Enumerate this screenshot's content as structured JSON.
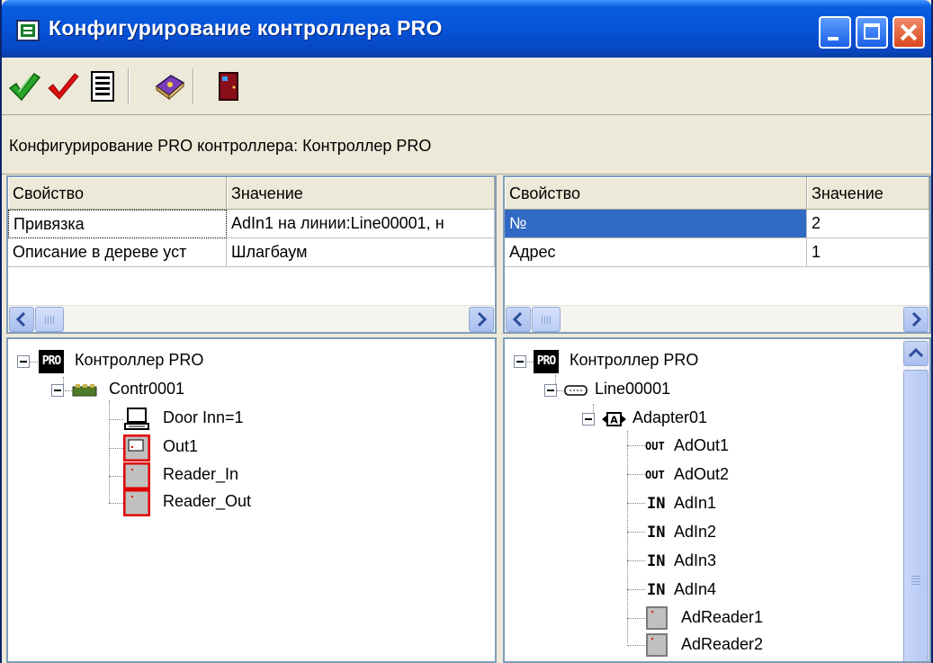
{
  "window": {
    "title": "Конфигурирование контроллера PRO"
  },
  "toolbar": {
    "buttons": [
      {
        "icon": "double-check-icon"
      },
      {
        "icon": "check-icon"
      },
      {
        "icon": "list-document-icon"
      },
      {
        "icon": "help-book-icon"
      },
      {
        "icon": "exit-door-icon"
      }
    ]
  },
  "caption": "Конфигурирование PRO контроллера: Контроллер PRO",
  "left_grid": {
    "headers": [
      "Свойство",
      "Значение"
    ],
    "rows": [
      [
        "Привязка",
        "AdIn1 на линии:Line00001, н"
      ],
      [
        "Описание в дереве уст",
        "Шлагбаум"
      ]
    ]
  },
  "right_grid": {
    "headers": [
      "Свойство",
      "Значение"
    ],
    "rows": [
      [
        "№",
        "2"
      ],
      [
        "Адрес",
        "1"
      ]
    ],
    "selected_row": 0
  },
  "left_tree": {
    "root": "Контроллер PRO",
    "root_icon_text": "PRO",
    "controller": "Contr0001",
    "children": [
      "Door Inn=1",
      "Out1",
      "Reader_In",
      "Reader_Out"
    ]
  },
  "right_tree": {
    "root": "Контроллер PRO",
    "root_icon_text": "PRO",
    "line": "Line00001",
    "adapter": "Adapter01",
    "adapter_badge": "A",
    "out_badge": "OUT",
    "in_badge": "IN",
    "outputs": [
      "AdOut1",
      "AdOut2"
    ],
    "inputs": [
      "AdIn1",
      "AdIn2",
      "AdIn3",
      "AdIn4"
    ],
    "readers": [
      "AdReader1",
      "AdReader2"
    ]
  },
  "colors": {
    "titlebar": "#0553d8",
    "selection": "#316ac5",
    "window_bg": "#ece9d8",
    "device_red": "#e00000"
  }
}
